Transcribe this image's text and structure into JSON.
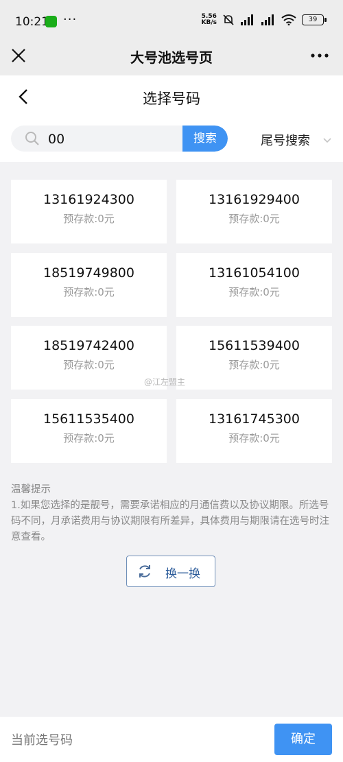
{
  "status_bar": {
    "time": "10:21",
    "dots": "···",
    "net_speed_value": "5.56",
    "net_speed_unit": "KB/s",
    "battery": "39"
  },
  "app_bar": {
    "title": "大号池选号页"
  },
  "page": {
    "title": "选择号码"
  },
  "search": {
    "value": "00",
    "button_label": "搜索",
    "tail_search_label": "尾号搜索"
  },
  "numbers": [
    {
      "number": "13161924300",
      "deposit": "预存款:0元"
    },
    {
      "number": "13161929400",
      "deposit": "预存款:0元"
    },
    {
      "number": "18519749800",
      "deposit": "预存款:0元"
    },
    {
      "number": "13161054100",
      "deposit": "预存款:0元"
    },
    {
      "number": "18519742400",
      "deposit": "预存款:0元"
    },
    {
      "number": "15611539400",
      "deposit": "预存款:0元"
    },
    {
      "number": "15611535400",
      "deposit": "预存款:0元"
    },
    {
      "number": "13161745300",
      "deposit": "预存款:0元"
    }
  ],
  "tips": {
    "title": "温馨提示",
    "body": "1.如果您选择的是靓号，需要承诺相应的月通信费以及协议期限。所选号码不同，月承诺费用与协议期限有所差异，具体费用与期限请在选号时注意查看。"
  },
  "refresh": {
    "label": "换一换"
  },
  "footer": {
    "current_label": "当前选号码",
    "confirm_label": "确定"
  },
  "watermark": "@江左盟主",
  "colors": {
    "accent": "#3f93f3",
    "refresh_border": "#6f8fb8",
    "page_bg": "#f2f2f4"
  }
}
